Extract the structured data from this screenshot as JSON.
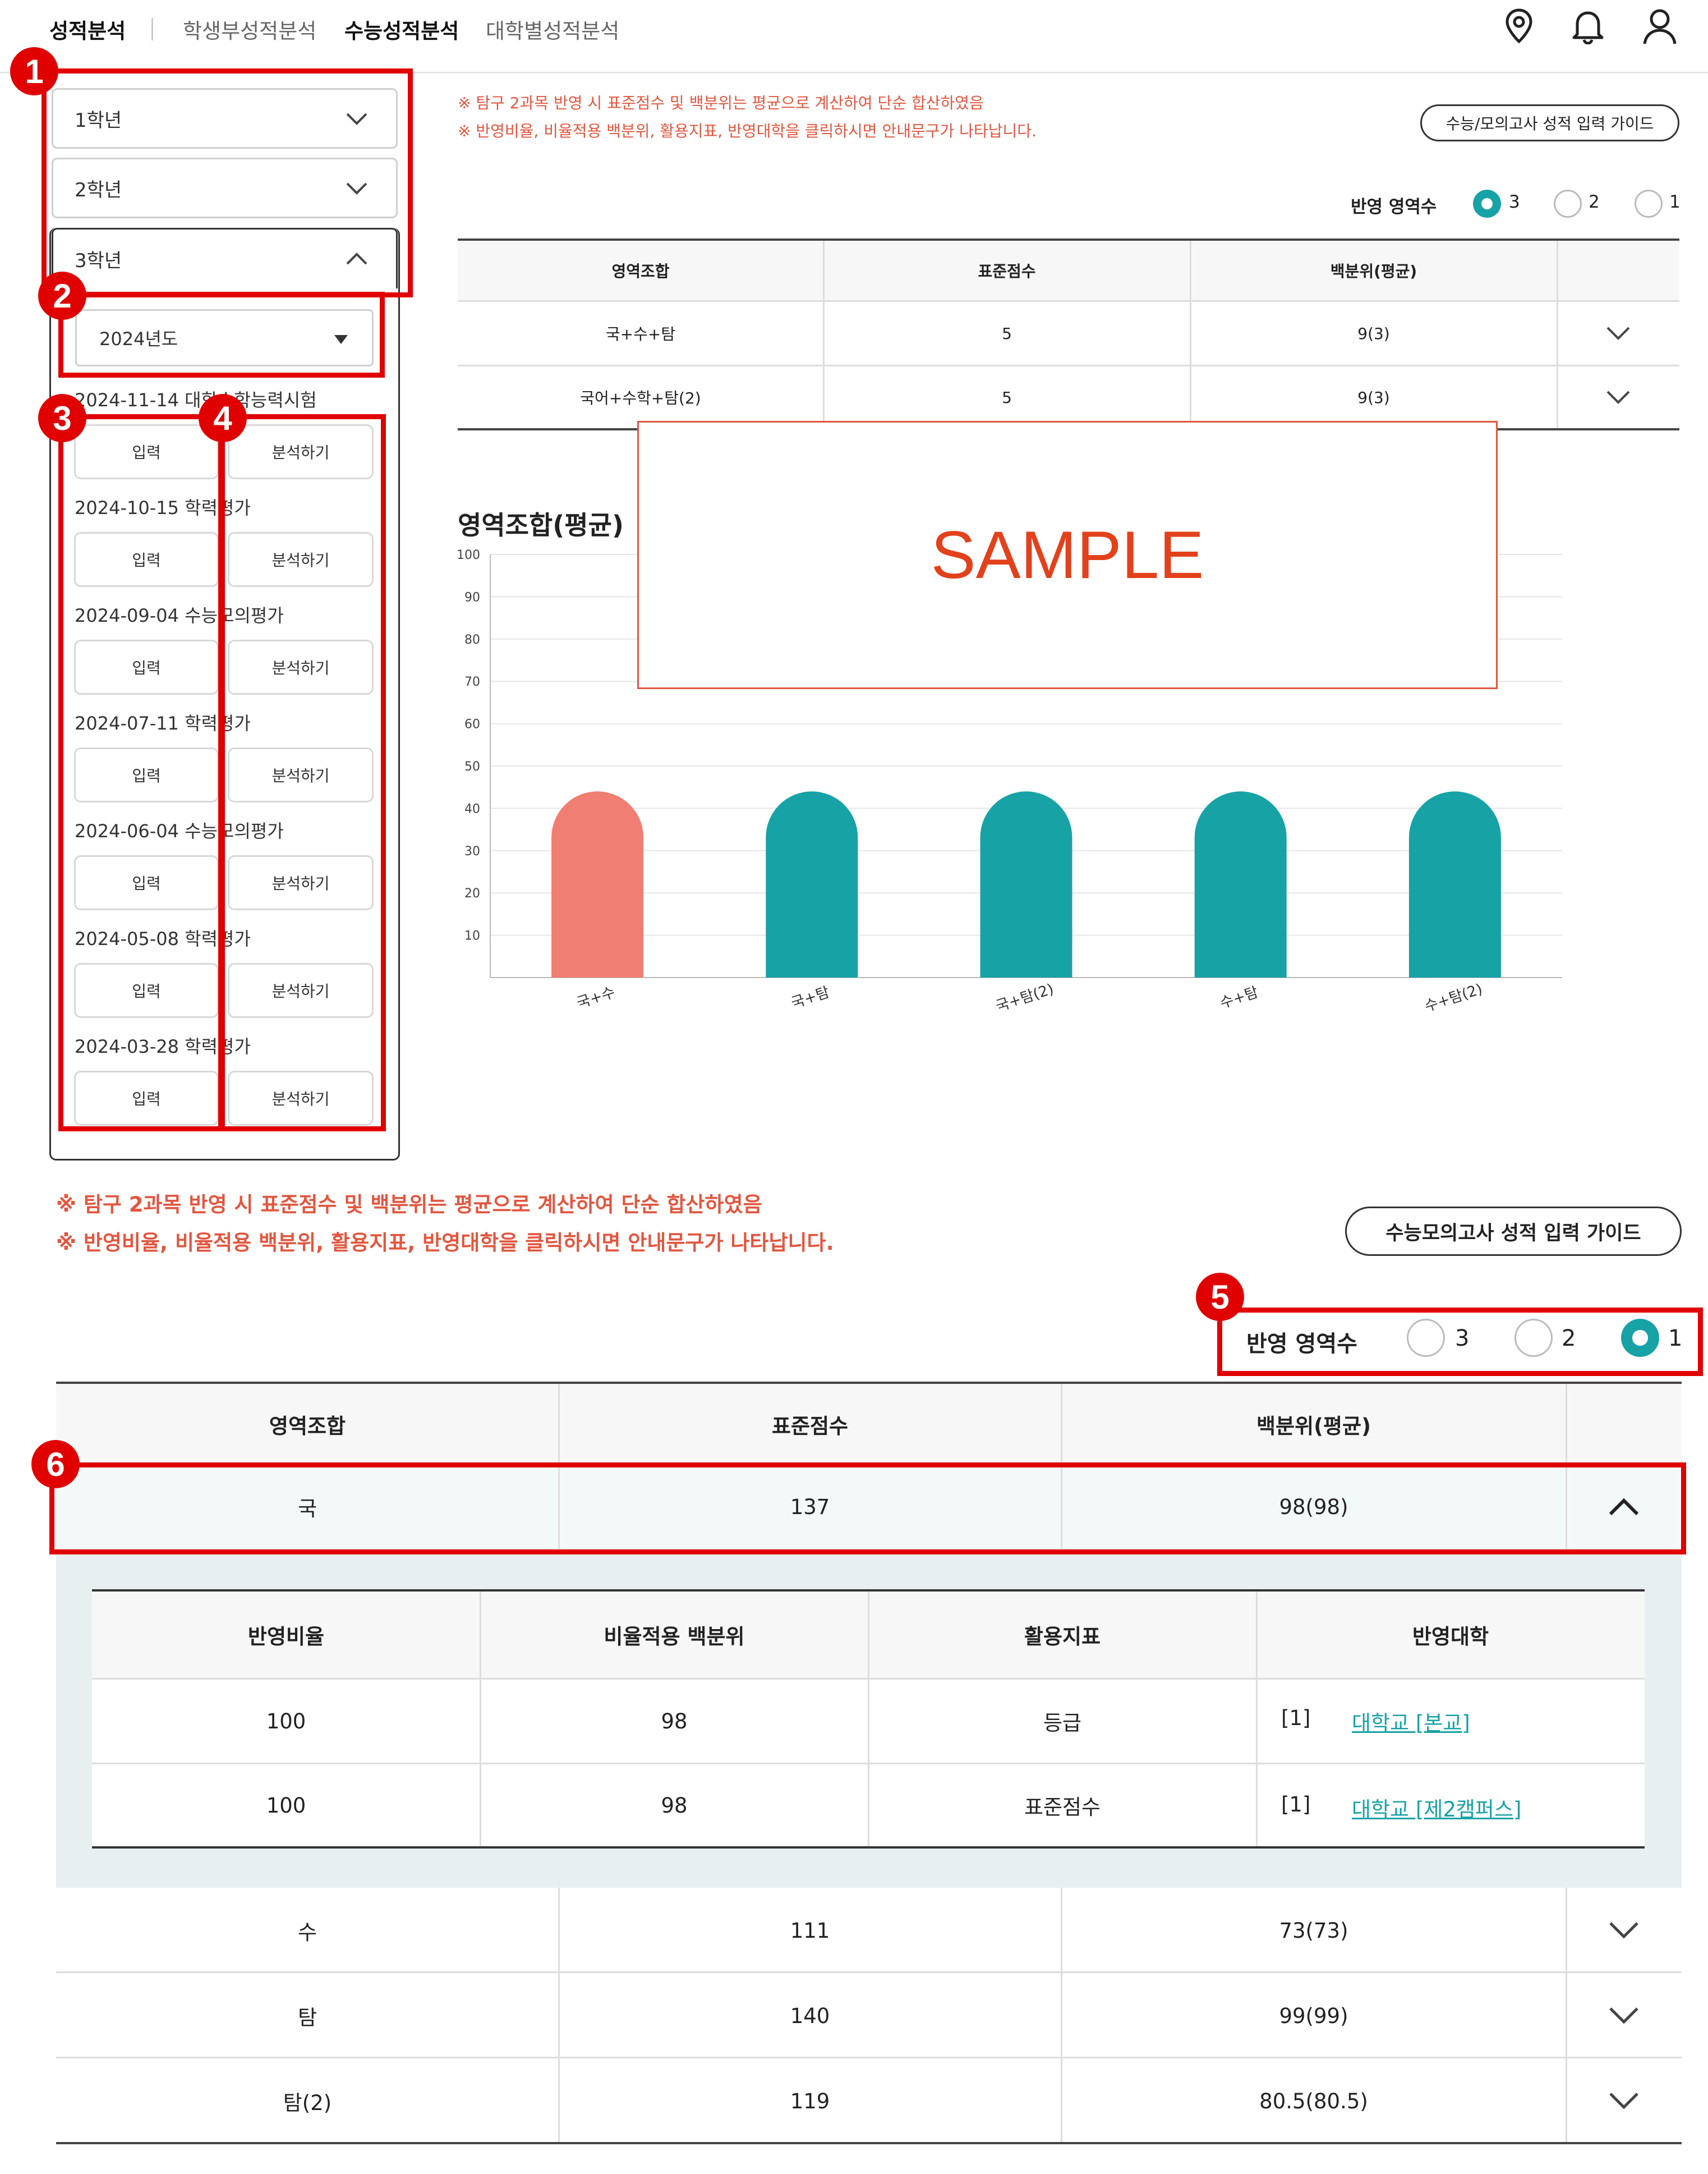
{
  "nav": {
    "items": [
      {
        "label": "성적분석"
      },
      {
        "label": "학생부성적분석"
      },
      {
        "label": "수능성적분석"
      },
      {
        "label": "대학별성적분석"
      }
    ]
  },
  "sidebar": {
    "grades": [
      {
        "label": "1학년"
      },
      {
        "label": "2학년"
      },
      {
        "label": "3학년"
      }
    ],
    "year_select": "2024년도",
    "input_label": "입력",
    "analyze_label": "분석하기",
    "exams": [
      {
        "label": "2024-11-14 대학수학능력시험"
      },
      {
        "label": "2024-10-15 학력평가"
      },
      {
        "label": "2024-09-04 수능모의평가"
      },
      {
        "label": "2024-07-11 학력평가"
      },
      {
        "label": "2024-06-04 수능모의평가"
      },
      {
        "label": "2024-05-08 학력평가"
      },
      {
        "label": "2024-03-28 학력평가"
      }
    ]
  },
  "badges": [
    "1",
    "2",
    "3",
    "4",
    "5",
    "6"
  ],
  "top_panel": {
    "note1": "※ 탐구 2과목 반영 시 표준점수 및 백분위는 평균으로 계산하여 단순 합산하였음",
    "note2": "※ 반영비율, 비율적용 백분위, 활용지표, 반영대학을 클릭하시면 안내문구가 나타납니다.",
    "guide_button": "수능/모의고사 성적 입력 가이드",
    "count_label": "반영 영역수",
    "radios": [
      "3",
      "2",
      "1"
    ],
    "selected": "3",
    "headers": [
      "영역조합",
      "표준점수",
      "백분위(평균)"
    ],
    "rows": [
      {
        "combo": "국+수+탐",
        "std": "5",
        "pct": "9(3)"
      },
      {
        "combo": "국어+수학+탐(2)",
        "std": "5",
        "pct": "9(3)"
      }
    ],
    "chart_title": "영역조합(평균)",
    "sample_text": "SAMPLE"
  },
  "chart_data": {
    "type": "bar",
    "title": "영역조합(평균)",
    "categories": [
      "국+수",
      "국+탐",
      "국+탐(2)",
      "수+탐",
      "수+탐(2)"
    ],
    "values": [
      44,
      44,
      44,
      44,
      44
    ],
    "colors": [
      "#f07e72",
      "#17a2a6",
      "#17a2a6",
      "#17a2a6",
      "#17a2a6"
    ],
    "ylim": [
      0,
      100
    ],
    "yticks": [
      10,
      20,
      30,
      40,
      50,
      60,
      70,
      80,
      90,
      100
    ],
    "grid": true
  },
  "bottom_panel": {
    "note1": "※ 탐구 2과목 반영 시 표준점수 및 백분위는 평균으로 계산하여 단순 합산하였음",
    "note2": "※ 반영비율, 비율적용 백분위, 활용지표, 반영대학을 클릭하시면 안내문구가 나타납니다.",
    "guide_button": "수능모의고사 성적 입력 가이드",
    "count_label": "반영 영역수",
    "radios": [
      "3",
      "2",
      "1"
    ],
    "selected": "1",
    "headers": [
      "영역조합",
      "표준점수",
      "백분위(평균)"
    ],
    "expanded_row": {
      "combo": "국",
      "std": "137",
      "pct": "98(98)"
    },
    "sub_headers": [
      "반영비율",
      "비율적용 백분위",
      "활용지표",
      "반영대학"
    ],
    "sub_rows": [
      {
        "ratio": "100",
        "pct": "98",
        "index": "등급",
        "univ_prefix": "[1]",
        "univ": "대학교 [본교]"
      },
      {
        "ratio": "100",
        "pct": "98",
        "index": "표준점수",
        "univ_prefix": "[1]",
        "univ": "대학교 [제2캠퍼스]"
      }
    ],
    "rows": [
      {
        "combo": "수",
        "std": "111",
        "pct": "73(73)"
      },
      {
        "combo": "탐",
        "std": "140",
        "pct": "99(99)"
      },
      {
        "combo": "탐(2)",
        "std": "119",
        "pct": "80.5(80.5)"
      }
    ]
  }
}
